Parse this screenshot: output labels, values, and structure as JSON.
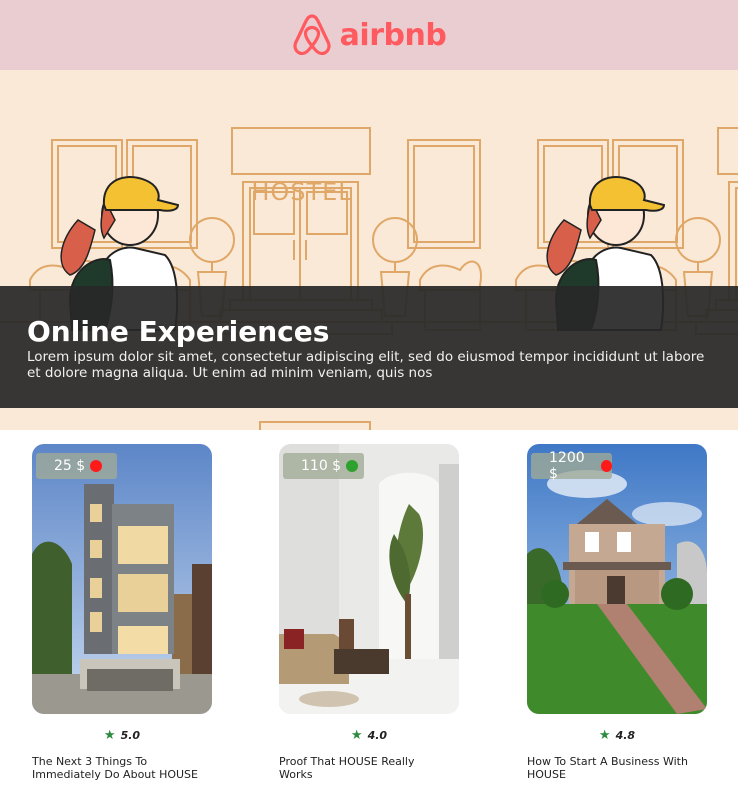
{
  "header": {
    "logo_text": "airbnb",
    "brand_color": "#ff5a5f",
    "background": "#eacdd0"
  },
  "hero": {
    "sign_text": "HOSTEL",
    "title": "Online Experiences",
    "description": "Lorem ipsum dolor sit amet, consectetur adipiscing elit, sed do eiusmod tempor incididunt ut labore et dolore magna aliqua. Ut enim ad minim veniam, quis nos"
  },
  "cards": [
    {
      "price": "25 $",
      "status_color": "#ff1a1a",
      "rating": "5.0",
      "title": "The Next 3 Things To Immediately Do About HOUSE"
    },
    {
      "price": "110 $",
      "status_color": "#2ea12e",
      "rating": "4.0",
      "title": "Proof That HOUSE Really Works"
    },
    {
      "price": "1200 $",
      "status_color": "#ff1a1a",
      "rating": "4.8",
      "title": "How To Start A Business With HOUSE"
    }
  ],
  "icons": {
    "rating": "star-icon",
    "brand": "airbnb-logo-icon"
  }
}
